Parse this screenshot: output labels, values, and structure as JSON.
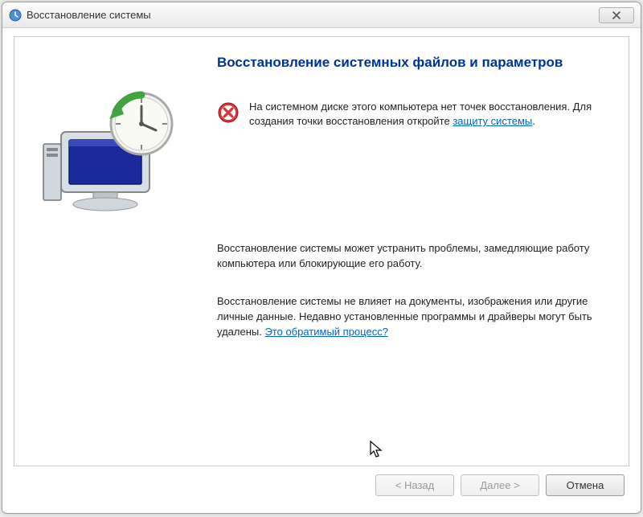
{
  "window": {
    "title": "Восстановление системы"
  },
  "content": {
    "heading": "Восстановление системных файлов и параметров",
    "error": {
      "text_before_link": "На системном диске этого компьютера нет точек восстановления. Для создания точки восстановления откройте ",
      "link": "защиту системы",
      "text_after_link": "."
    },
    "para1": "Восстановление системы может устранить проблемы, замедляющие работу компьютера или блокирующие его работу.",
    "para2_before_link": "Восстановление системы не влияет на документы, изображения или другие личные данные. Недавно установленные программы и драйверы могут быть удалены. ",
    "para2_link": "Это обратимый процесс?"
  },
  "buttons": {
    "back": "< Назад",
    "next": "Далее >",
    "cancel": "Отмена"
  }
}
